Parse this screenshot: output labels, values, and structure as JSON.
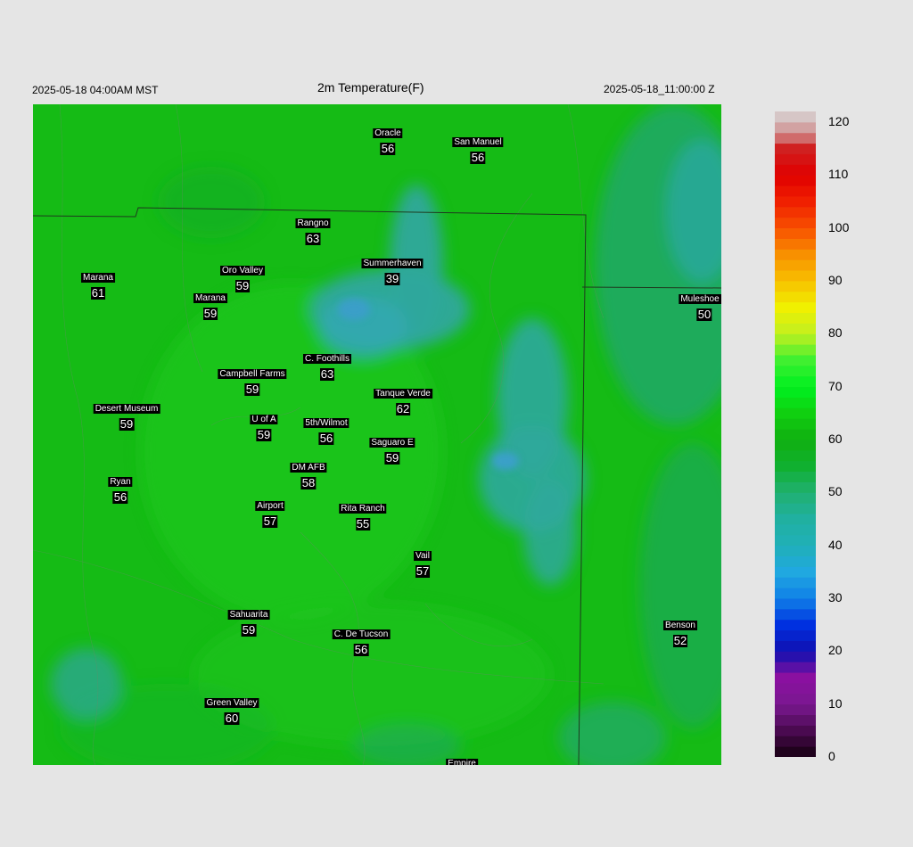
{
  "header": {
    "local_time": "2025-05-18 04:00AM MST",
    "title": "2m Temperature(F)",
    "utc_time": "2025-05-18_11:00:00 Z"
  },
  "colors": {
    "background": "#e5e5e5",
    "base_green": "#16be16",
    "cool_mountain": "#2ea8a0",
    "label_bg": "#000000",
    "label_text": "#ffffff"
  },
  "stations": [
    {
      "name": "Oracle",
      "temp": "56"
    },
    {
      "name": "San Manuel",
      "temp": "56"
    },
    {
      "name": "Rangno",
      "temp": "63"
    },
    {
      "name": "Summerhaven",
      "temp": "39"
    },
    {
      "name": "Marana",
      "temp": "61"
    },
    {
      "name": "Oro Valley",
      "temp": "59"
    },
    {
      "name": "Marana",
      "temp": "59"
    },
    {
      "name": "Mule​shoe R",
      "temp": "50"
    },
    {
      "name": "C. Foothills",
      "temp": "63"
    },
    {
      "name": "Campbell Farms",
      "temp": "59"
    },
    {
      "name": "Tanque Verde",
      "temp": "62"
    },
    {
      "name": "Desert Museum",
      "temp": "59"
    },
    {
      "name": "U of A",
      "temp": "59"
    },
    {
      "name": "5th/Wilmot",
      "temp": "56"
    },
    {
      "name": "Saguaro E",
      "temp": "59"
    },
    {
      "name": "DM AFB",
      "temp": "58"
    },
    {
      "name": "Ryan",
      "temp": "56"
    },
    {
      "name": "Airport",
      "temp": "57"
    },
    {
      "name": "Rita Ranch",
      "temp": "55"
    },
    {
      "name": "Vail",
      "temp": "57"
    },
    {
      "name": "Benson",
      "temp": "52"
    },
    {
      "name": "Sahuarita",
      "temp": "59"
    },
    {
      "name": "C. De Tucson",
      "temp": "56"
    },
    {
      "name": "Green Valley",
      "temp": "60"
    },
    {
      "name": "Empire",
      "temp": ""
    }
  ],
  "colorbar": {
    "min": 0,
    "max": 122,
    "ticks": [
      "0",
      "10",
      "20",
      "30",
      "40",
      "50",
      "60",
      "70",
      "80",
      "90",
      "100",
      "110",
      "120"
    ]
  }
}
